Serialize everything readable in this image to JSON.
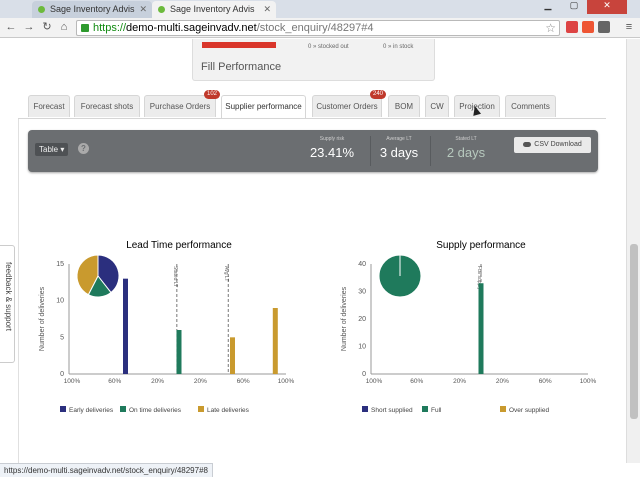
{
  "browser": {
    "tabs": [
      {
        "title": "Sage Inventory Advis",
        "active": false
      },
      {
        "title": "Sage Inventory Advis",
        "active": true
      }
    ],
    "url_scheme": "https://",
    "url_host": "demo-multi.sageinvadv.net",
    "url_path": "/stock_enquiry/48297#4",
    "status_url": "https://demo-multi.sageinvadv.net/stock_enquiry/48297#8"
  },
  "fill_card": {
    "title": "Fill Performance",
    "stocked_out": "0 » stocked out",
    "in_stock": "0 » in stock"
  },
  "tabs": [
    {
      "label": "Forecast",
      "badge": ""
    },
    {
      "label": "Forecast shots",
      "badge": ""
    },
    {
      "label": "Purchase Orders",
      "badge": "102"
    },
    {
      "label": "Supplier performance",
      "badge": ""
    },
    {
      "label": "Customer Orders",
      "badge": "240"
    },
    {
      "label": "BOM",
      "badge": ""
    },
    {
      "label": "CW",
      "badge": ""
    },
    {
      "label": "Projection",
      "badge": ""
    },
    {
      "label": "Comments",
      "badge": ""
    }
  ],
  "active_tab": "Supplier performance",
  "statbar": {
    "view_select": "Table ▾",
    "help": "?",
    "supply_risk_label": "Supply risk",
    "supply_risk": "23.41%",
    "avg_lt_label": "Average LT",
    "avg_lt": "3 days",
    "stated_lt_label": "Stated LT",
    "stated_lt": "2 days",
    "csv_label": "CSV Download"
  },
  "feedback_label": "feedback & support",
  "colors": {
    "early": "#2b2f7e",
    "on_time": "#1f7a5c",
    "late": "#c99a2e",
    "red": "#d9362b"
  },
  "chart_data": [
    {
      "type": "bar",
      "title": "Lead Time performance",
      "ylabel": "Number of deliveries",
      "ylim": [
        0,
        15
      ],
      "yticks": [
        0,
        5,
        10,
        15
      ],
      "xticks": [
        "100%",
        "60%",
        "20%",
        "20%",
        "60%",
        "100%"
      ],
      "markers": [
        {
          "label": "Stated LT",
          "x": 0.49
        },
        {
          "label": "Avg LT",
          "x": 0.73
        }
      ],
      "series": [
        {
          "name": "Early deliveries",
          "color": "#2b2f7e",
          "x": [
            0.25
          ],
          "values": [
            13
          ]
        },
        {
          "name": "On time deliveries",
          "color": "#1f7a5c",
          "x": [
            0.5
          ],
          "values": [
            6
          ]
        },
        {
          "name": "Late deliveries",
          "color": "#c99a2e",
          "x": [
            0.75,
            0.95
          ],
          "values": [
            5,
            9
          ]
        }
      ],
      "pie": [
        {
          "name": "Early deliveries",
          "value": 13,
          "color": "#2b2f7e"
        },
        {
          "name": "On time deliveries",
          "value": 6,
          "color": "#1f7a5c"
        },
        {
          "name": "Late deliveries",
          "value": 14,
          "color": "#c99a2e"
        }
      ],
      "legend": "bottom"
    },
    {
      "type": "bar",
      "title": "Supply performance",
      "ylabel": "Number of deliveries",
      "ylim": [
        0,
        40
      ],
      "yticks": [
        0,
        10,
        20,
        30,
        40
      ],
      "xticks": [
        "100%",
        "60%",
        "20%",
        "20%",
        "60%",
        "100%"
      ],
      "markers": [
        {
          "label": "Full supply",
          "x": 0.5
        }
      ],
      "series": [
        {
          "name": "Short supplied",
          "color": "#2b2f7e",
          "x": [],
          "values": []
        },
        {
          "name": "Full",
          "color": "#1f7a5c",
          "x": [
            0.5
          ],
          "values": [
            33
          ]
        },
        {
          "name": "Over supplied",
          "color": "#c99a2e",
          "x": [],
          "values": []
        }
      ],
      "pie": [
        {
          "name": "Full",
          "value": 33,
          "color": "#1f7a5c"
        }
      ],
      "legend": "bottom"
    }
  ]
}
